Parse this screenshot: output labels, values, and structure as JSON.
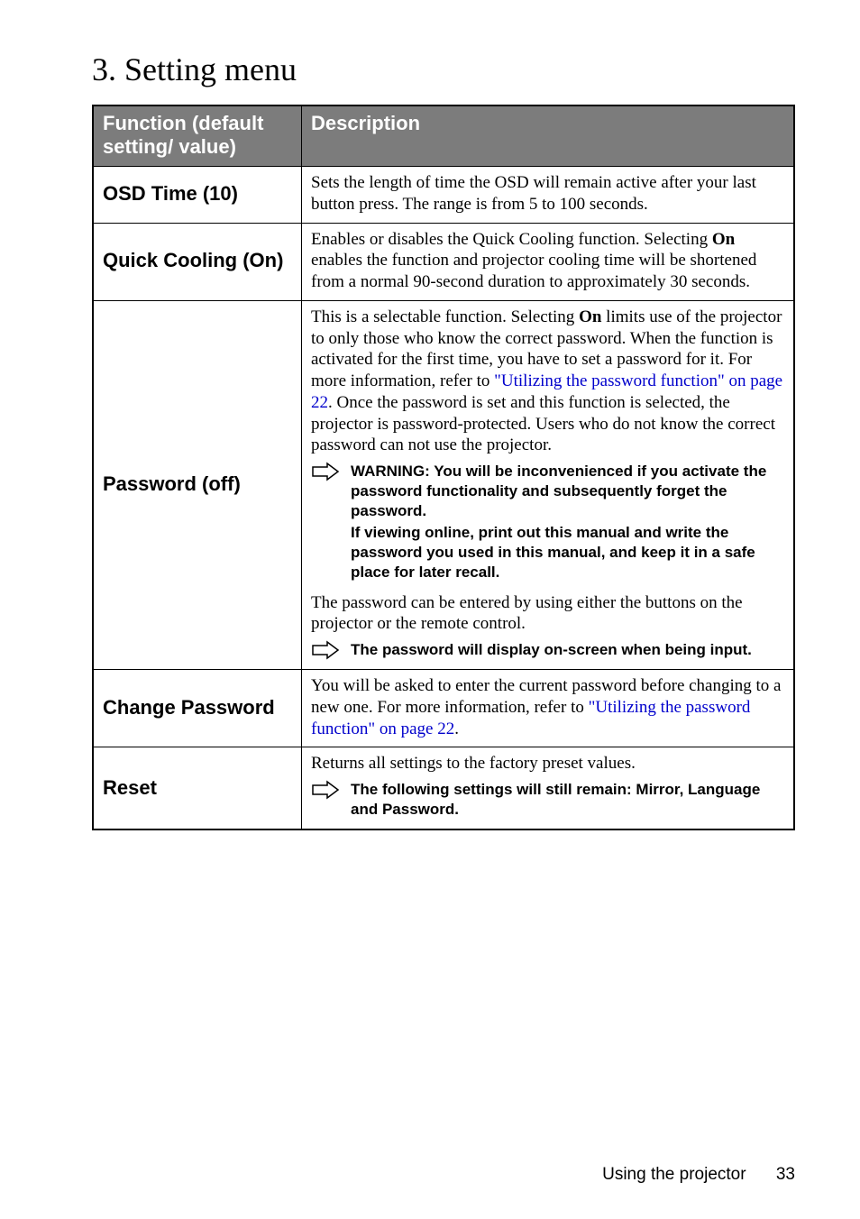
{
  "section_title": "3. Setting menu",
  "table": {
    "head": {
      "function": "Function (default setting/ value)",
      "description": "Description"
    },
    "rows": {
      "osd_time": {
        "func": "OSD Time (10)",
        "desc": "Sets the length of time the OSD will remain active after your last button press. The range is from 5 to 100 seconds."
      },
      "quick_cooling": {
        "func": "Quick Cooling (On)",
        "p1a": "Enables or disables the Quick Cooling function. Selecting ",
        "p1bold": "On",
        "p1b": " enables the function and projector cooling time will be shortened from a normal 90-second duration to approximately 30 seconds."
      },
      "password": {
        "func": "Password (off)",
        "p1a": "This is a selectable function. Selecting ",
        "p1bold": "On",
        "p1b": " limits use of the projector to only those who know the correct password. When the function is activated for the first time, you have to set a password for it. For more information, refer to ",
        "p1link": "\"Utilizing the password function\" on page 22",
        "p1c": ". Once the password is set and this function is selected, the projector is password-protected. Users who do not know the correct password can not use the projector.",
        "warn1": "WARNING: You will be inconvenienced if you activate the password functionality and subsequently forget the password.",
        "warn2": "If viewing online, print out this manual and write the password you used in this manual, and keep it in a safe place for later recall.",
        "p2": "The password can be entered by using either the buttons on the projector or the remote control.",
        "note3": "The password will display on-screen when being input."
      },
      "change_password": {
        "func": "Change Password",
        "p1a": "You will be asked to enter the current password before changing to a new one. For more information, refer to ",
        "p1link": "\"Utilizing the password function\" on page 22",
        "p1b": "."
      },
      "reset": {
        "func": "Reset",
        "p1": "Returns all settings to the factory preset values.",
        "note": "The following settings will still remain: Mirror, Language and Password."
      }
    }
  },
  "footer": {
    "label": "Using the projector",
    "page": "33"
  }
}
